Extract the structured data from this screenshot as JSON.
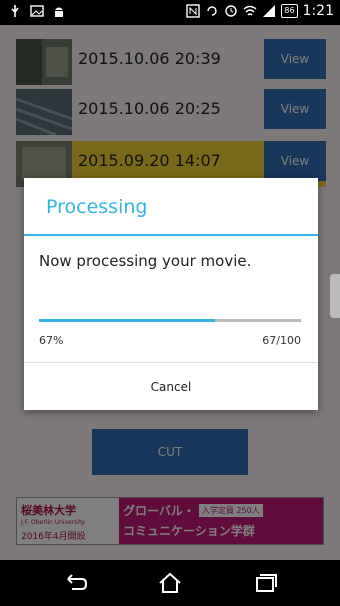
{
  "status_bar": {
    "left_icons": [
      "usb-icon",
      "image-icon",
      "android-icon"
    ],
    "right_icons": [
      "nfc-icon",
      "rotation-icon",
      "alarm-icon",
      "wifi-icon",
      "signal-icon"
    ],
    "battery": "86",
    "time": "1:21"
  },
  "list": {
    "rows": [
      {
        "timestamp": "2015.10.06 20:39",
        "view_label": "View"
      },
      {
        "timestamp": "2015.10.06 20:25",
        "view_label": "View"
      },
      {
        "timestamp": "2015.09.20 14:07",
        "view_label": "View"
      }
    ]
  },
  "cut_button": {
    "label": "CUT"
  },
  "ad": {
    "school": "桜美林大学",
    "school_sub": "J.F. Oberlin University",
    "date": "2016年4月開設",
    "line1": "グローバル・",
    "badge": "入学定員 250人",
    "line2": "コミュニケーション学群"
  },
  "dialog": {
    "title": "Processing",
    "message": "Now processing your movie.",
    "progress": {
      "value": 67,
      "max": 100,
      "percent_label": "67%",
      "count_label": "67/100"
    },
    "cancel_label": "Cancel"
  },
  "nav_bar": {
    "icons": [
      "back-icon",
      "home-icon",
      "recents-icon"
    ]
  },
  "colors": {
    "accent": "#33b5e5",
    "button": "#2f6fb6",
    "background": "#fbf1f4"
  }
}
